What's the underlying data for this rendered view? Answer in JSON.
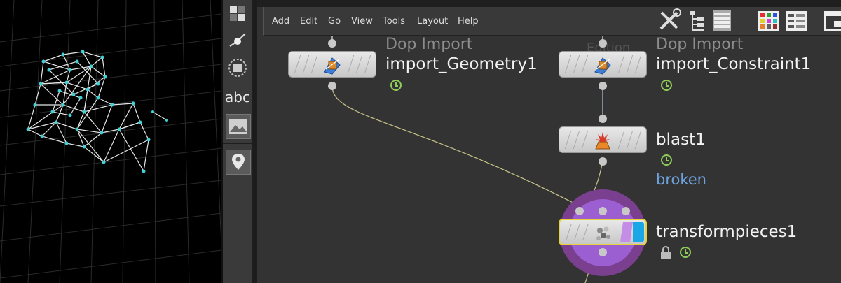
{
  "menubar": {
    "items": [
      "Add",
      "Edit",
      "Go",
      "View",
      "Tools",
      "Layout",
      "Help"
    ]
  },
  "toolstrip": {
    "text_tool_label": "abc",
    "tools": [
      "select-icon",
      "transform-icon",
      "handle-icon",
      "text-tool-icon",
      "image-icon",
      "pin-icon"
    ]
  },
  "toolbar_icons": [
    "wrench-icon",
    "tree-icon",
    "list-icon",
    "color-palette-icon",
    "parameters-icon",
    "window-icon"
  ],
  "nodes": {
    "import_geometry": {
      "type": "Dop Import",
      "name": "import_Geometry1"
    },
    "import_constraint": {
      "type": "Dop Import",
      "name": "import_Constraint1",
      "ghost_text": "Edition"
    },
    "blast": {
      "name": "blast1",
      "status": "broken"
    },
    "transformpieces": {
      "name": "transformpieces1"
    }
  },
  "colors": {
    "network_bg": "#333333",
    "node_selected_border": "#e8d23a",
    "wire": "#c9c58a",
    "status_broken": "#6ea3e0",
    "flag_purple": "#c48de6",
    "flag_blue": "#1aa7e8",
    "halo_outer": "#7a3f8e",
    "halo_inner": "#9c5fd1"
  }
}
